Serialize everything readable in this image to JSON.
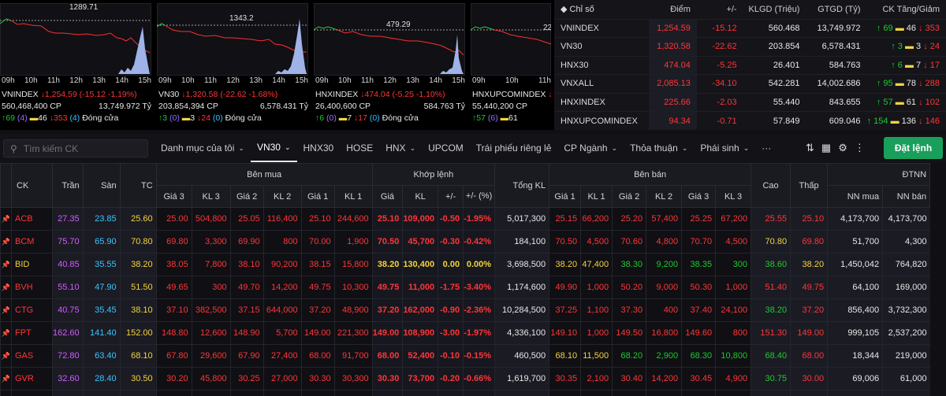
{
  "mini_charts": [
    {
      "name": "VNINDEX",
      "peak": "1289.71",
      "ref_label": "",
      "times": [
        "09h",
        "10h",
        "11h",
        "12h",
        "13h",
        "14h",
        "15h"
      ],
      "price": "1,254.59",
      "change": "(-15.12 -1.19%)",
      "volume": "560,468,400 CP",
      "value": "13,749.972 Tỷ",
      "adv": "69",
      "adv_ceil": "(4)",
      "unch": "46",
      "dec": "353",
      "dec_floor": "(4)",
      "status": "Đóng cửa",
      "dir": "down"
    },
    {
      "name": "VN30",
      "peak": "1343.2",
      "ref_label": "",
      "times": [
        "09h",
        "10h",
        "11h",
        "12h",
        "13h",
        "14h",
        "15h"
      ],
      "price": "1,320.58",
      "change": "(-22.62 -1.68%)",
      "volume": "203,854,394 CP",
      "value": "6,578.431 Tỷ",
      "adv": "3",
      "adv_ceil": "(0)",
      "unch": "3",
      "dec": "24",
      "dec_floor": "(0)",
      "status": "Đóng cửa",
      "dir": "down"
    },
    {
      "name": "HNXINDEX",
      "peak": "479.29",
      "ref_label": "",
      "times": [
        "09h",
        "10h",
        "11h",
        "12h",
        "13h",
        "14h",
        "15h"
      ],
      "price": "474.04",
      "change": "(-5.25 -1.10%)",
      "volume": "26,400,600 CP",
      "value": "584.763 Tỷ",
      "adv": "6",
      "adv_ceil": "(0)",
      "unch": "7",
      "dec": "17",
      "dec_floor": "(0)",
      "status": "Đóng cửa",
      "dir": "down"
    },
    {
      "name": "HNXUPCOMINDEX",
      "peak": "22",
      "ref_label": "",
      "times": [
        "09h",
        "10h",
        "11h"
      ],
      "price": "",
      "change": "",
      "volume": "55,440,200 CP",
      "value": "",
      "adv": "57",
      "adv_ceil": "(6)",
      "unch": "61",
      "dec": "",
      "dec_floor": "",
      "status": "",
      "dir": "down"
    }
  ],
  "index_table": {
    "headers": [
      "Chỉ số",
      "Điểm",
      "+/-",
      "KLGD (Triệu)",
      "GTGD (Tỷ)",
      "CK Tăng/Giảm"
    ],
    "rows": [
      {
        "name": "VNINDEX",
        "point": "1,254.59",
        "chg": "-15.12",
        "vol": "560.468",
        "val": "13,749.972",
        "up": "69",
        "same": "46",
        "down": "353"
      },
      {
        "name": "VN30",
        "point": "1,320.58",
        "chg": "-22.62",
        "vol": "203.854",
        "val": "6,578.431",
        "up": "3",
        "same": "3",
        "down": "24"
      },
      {
        "name": "HNX30",
        "point": "474.04",
        "chg": "-5.25",
        "vol": "26.401",
        "val": "584.763",
        "up": "6",
        "same": "7",
        "down": "17"
      },
      {
        "name": "VNXALL",
        "point": "2,085.13",
        "chg": "-34.10",
        "vol": "542.281",
        "val": "14,002.686",
        "up": "95",
        "same": "78",
        "down": "288"
      },
      {
        "name": "HNXINDEX",
        "point": "225.66",
        "chg": "-2.03",
        "vol": "55.440",
        "val": "843.655",
        "up": "57",
        "same": "61",
        "down": "102"
      },
      {
        "name": "HNXUPCOMINDEX",
        "point": "94.34",
        "chg": "-0.71",
        "vol": "57.849",
        "val": "609.046",
        "up": "154",
        "same": "136",
        "down": "146"
      }
    ]
  },
  "toolbar": {
    "search_placeholder": "Tìm kiếm CK",
    "tabs": [
      "Danh mục của tôi",
      "VN30",
      "HNX30",
      "HOSE",
      "HNX",
      "UPCOM",
      "Trái phiếu riêng lẻ",
      "CP Ngành",
      "Thỏa thuận",
      "Phái sinh",
      "···"
    ],
    "order_button": "Đặt lệnh"
  },
  "board": {
    "group_headers": {
      "ck": "CK",
      "tran": "Trần",
      "san": "Sàn",
      "tc": "TC",
      "buy": "Bên mua",
      "match": "Khớp lệnh",
      "total": "Tổng KL",
      "sell": "Bên bán",
      "high": "Cao",
      "low": "Thấp",
      "foreign": "ĐTNN"
    },
    "sub_headers": {
      "b3": "Giá 3",
      "kb3": "KL 3",
      "b2": "Giá 2",
      "kb2": "KL 2",
      "b1": "Giá 1",
      "kb1": "KL 1",
      "mp": "Giá",
      "mv": "KL",
      "chg": "+/-",
      "pct": "+/- (%)",
      "s1": "Giá 1",
      "ks1": "KL 1",
      "s2": "Giá 2",
      "ks2": "KL 2",
      "s3": "Giá 3",
      "ks3": "KL 3",
      "nnb": "NN mua",
      "nns": "NN bán"
    },
    "rows": [
      [
        "ACB",
        "27.35",
        "23.85",
        "25.60",
        "25.00",
        "504,800",
        "25.05",
        "116,400",
        "25.10",
        "244,600",
        "25.10",
        "109,000",
        "-0.50",
        "-1.95%",
        "5,017,300",
        "25.15",
        "66,200",
        "25.20",
        "57,400",
        "25.25",
        "67,200",
        "25.55",
        "25.10",
        "4,173,700",
        "4,173,700"
      ],
      [
        "BCM",
        "75.70",
        "65.90",
        "70.80",
        "69.80",
        "3,300",
        "69.90",
        "800",
        "70.00",
        "1,900",
        "70.50",
        "45,700",
        "-0.30",
        "-0.42%",
        "184,100",
        "70.50",
        "4,500",
        "70.60",
        "4,800",
        "70.70",
        "4,500",
        "70.80",
        "69.80",
        "51,700",
        "4,300"
      ],
      [
        "BID",
        "40.85",
        "35.55",
        "38.20",
        "38.05",
        "7,800",
        "38.10",
        "90,200",
        "38.15",
        "15,800",
        "38.20",
        "130,400",
        "0.00",
        "0.00%",
        "3,698,500",
        "38.20",
        "47,400",
        "38.30",
        "9,200",
        "38.35",
        "300",
        "38.60",
        "38.20",
        "1,450,042",
        "764,820"
      ],
      [
        "BVH",
        "55.10",
        "47.90",
        "51.50",
        "49.65",
        "300",
        "49.70",
        "14,200",
        "49.75",
        "10,300",
        "49.75",
        "11,000",
        "-1.75",
        "-3.40%",
        "1,174,600",
        "49.90",
        "1,000",
        "50.20",
        "9,000",
        "50.30",
        "1,000",
        "51.40",
        "49.75",
        "64,100",
        "169,000"
      ],
      [
        "CTG",
        "40.75",
        "35.45",
        "38.10",
        "37.10",
        "382,500",
        "37.15",
        "644,000",
        "37.20",
        "48,900",
        "37.20",
        "162,000",
        "-0.90",
        "-2.36%",
        "10,284,500",
        "37.25",
        "1,100",
        "37.30",
        "400",
        "37.40",
        "24,100",
        "38.20",
        "37.20",
        "856,400",
        "3,732,300"
      ],
      [
        "FPT",
        "162.60",
        "141.40",
        "152.00",
        "148.80",
        "12,600",
        "148.90",
        "5,700",
        "149.00",
        "221,300",
        "149.00",
        "108,900",
        "-3.00",
        "-1.97%",
        "4,336,100",
        "149.10",
        "1,000",
        "149.50",
        "16,800",
        "149.60",
        "800",
        "151.30",
        "149.00",
        "999,105",
        "2,537,200"
      ],
      [
        "GAS",
        "72.80",
        "63.40",
        "68.10",
        "67.80",
        "29,600",
        "67.90",
        "27,400",
        "68.00",
        "91,700",
        "68.00",
        "52,400",
        "-0.10",
        "-0.15%",
        "460,500",
        "68.10",
        "11,500",
        "68.20",
        "2,900",
        "68.30",
        "10,800",
        "68.40",
        "68.00",
        "18,344",
        "219,000"
      ],
      [
        "GVR",
        "32.60",
        "28.40",
        "30.50",
        "30.20",
        "45,800",
        "30.25",
        "27,000",
        "30.30",
        "30,300",
        "30.30",
        "73,700",
        "-0.20",
        "-0.66%",
        "1,619,700",
        "30.35",
        "2,100",
        "30.40",
        "14,200",
        "30.45",
        "4,900",
        "30.75",
        "30.00",
        "69,006",
        "61,000"
      ],
      [
        "HDB",
        "26.85",
        "23.35",
        "25.10",
        "24.35",
        "60,600",
        "24.40",
        "27,600",
        "24.45",
        "84,400",
        "24.45",
        "154,500",
        "-0.65",
        "-2.59%",
        "7,212,300",
        "24.50",
        "28,400",
        "24.55",
        "21,400",
        "24.65",
        "4,000",
        "25.00",
        "24.45",
        "226,100",
        "3,100"
      ]
    ]
  }
}
